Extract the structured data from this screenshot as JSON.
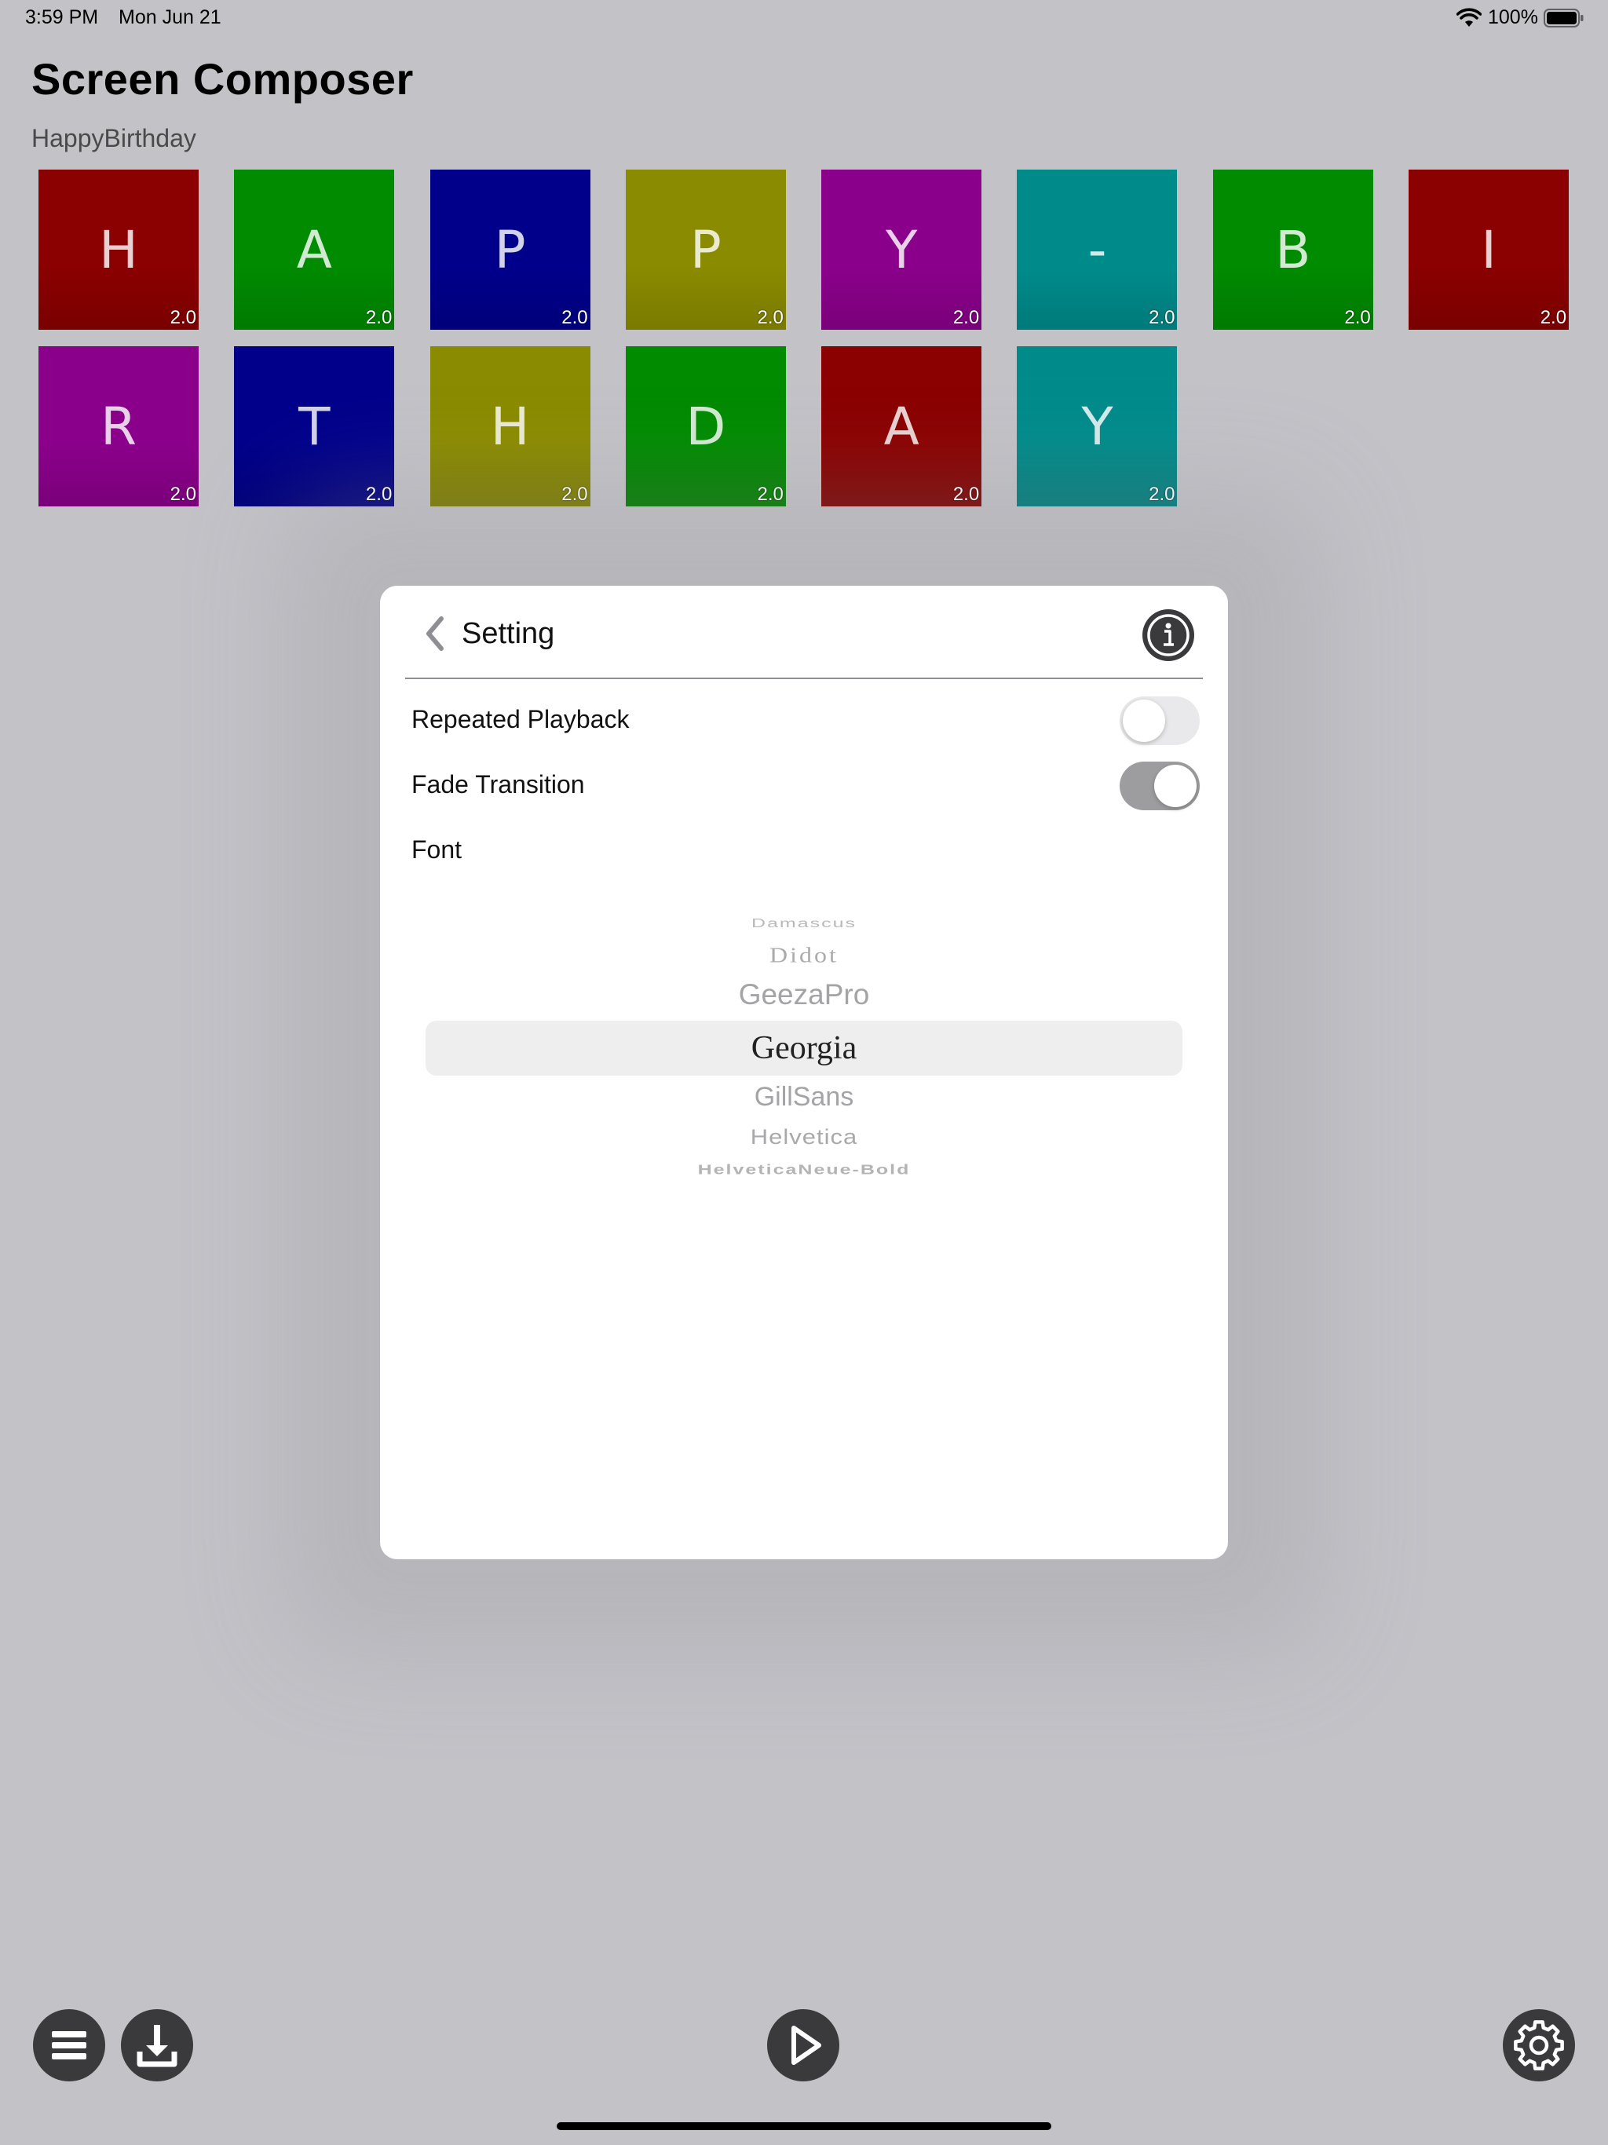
{
  "status_bar": {
    "time": "3:59 PM",
    "date": "Mon Jun 21",
    "battery_percent": "100%",
    "wifi_icon": "wifi-icon",
    "battery_icon": "battery-icon",
    "battery_level": 1.0
  },
  "header": {
    "title": "Screen Composer",
    "project_name": "HappyBirthday"
  },
  "tiles": [
    {
      "letter": "H",
      "duration": "2.0",
      "color": "#8b0000"
    },
    {
      "letter": "A",
      "duration": "2.0",
      "color": "#008b00"
    },
    {
      "letter": "P",
      "duration": "2.0",
      "color": "#00008b"
    },
    {
      "letter": "P",
      "duration": "2.0",
      "color": "#8b8b00"
    },
    {
      "letter": "Y",
      "duration": "2.0",
      "color": "#8b008b"
    },
    {
      "letter": "-",
      "duration": "2.0",
      "color": "#008b8b"
    },
    {
      "letter": "B",
      "duration": "2.0",
      "color": "#008b00"
    },
    {
      "letter": "I",
      "duration": "2.0",
      "color": "#8b0000"
    },
    {
      "letter": "R",
      "duration": "2.0",
      "color": "#8b008b"
    },
    {
      "letter": "T",
      "duration": "2.0",
      "color": "#00008b"
    },
    {
      "letter": "H",
      "duration": "2.0",
      "color": "#8b8b00"
    },
    {
      "letter": "D",
      "duration": "2.0",
      "color": "#008b00"
    },
    {
      "letter": "A",
      "duration": "2.0",
      "color": "#8b0000"
    },
    {
      "letter": "Y",
      "duration": "2.0",
      "color": "#008b8b"
    }
  ],
  "settings": {
    "title": "Setting",
    "back_icon": "chevron-left-icon",
    "info_icon": "info-icon",
    "repeated_playback": {
      "label": "Repeated Playback",
      "enabled": false
    },
    "fade_transition": {
      "label": "Fade Transition",
      "enabled": true
    },
    "font": {
      "label": "Font",
      "options": [
        "Damascus",
        "Didot",
        "GeezaPro",
        "Georgia",
        "GillSans",
        "Helvetica",
        "HelveticaNeue-Bold"
      ],
      "selected": "Georgia"
    }
  },
  "toolbar": {
    "menu_icon": "menu-icon",
    "download_icon": "download-icon",
    "play_icon": "play-icon",
    "settings_icon": "gear-icon"
  },
  "colors": {
    "background": "#c2c2c7",
    "button_dark": "#3a3a3c",
    "toggle_on": "#9d9d9f",
    "toggle_off": "#e9e9eb"
  }
}
